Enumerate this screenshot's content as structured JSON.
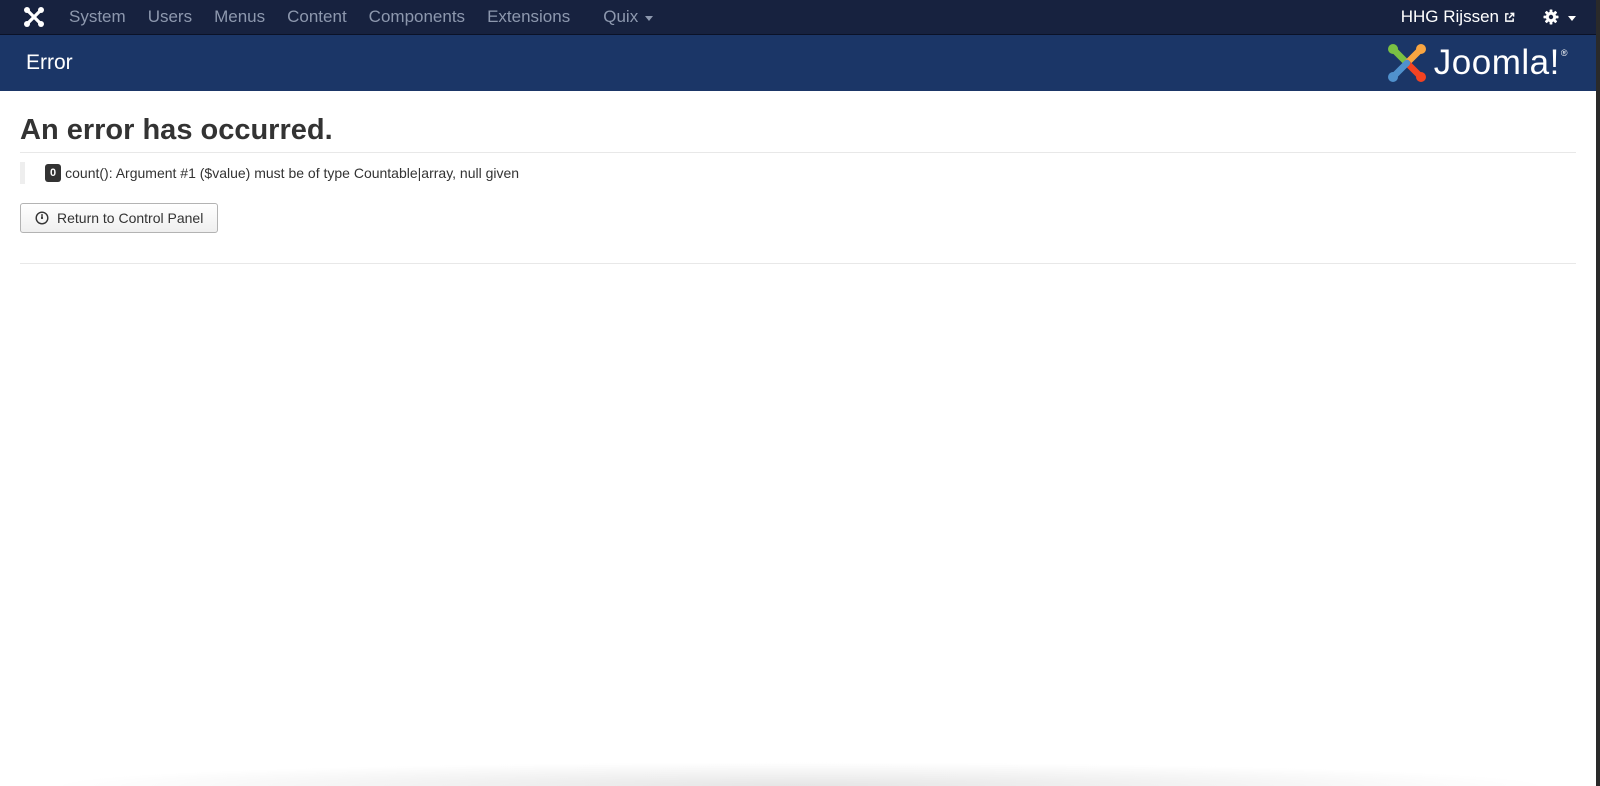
{
  "navbar": {
    "logo_icon": "joomla-icon",
    "menu": [
      "System",
      "Users",
      "Menus",
      "Content",
      "Components",
      "Extensions"
    ],
    "quix_label": "Quix",
    "site_link": "HHG Rijssen",
    "settings_icon": "gear-icon"
  },
  "header": {
    "title": "Error",
    "brand_text": "Joomla!",
    "brand_reg": "®"
  },
  "main": {
    "error_title": "An error has occurred.",
    "error_code": "0",
    "error_message": "count(): Argument #1 ($value) must be of type Countable|array, null given",
    "return_button": "Return to Control Panel"
  },
  "colors": {
    "navbar_bg": "#17223f",
    "header_bg": "#1b3667",
    "nav_text": "#8d98ae"
  }
}
